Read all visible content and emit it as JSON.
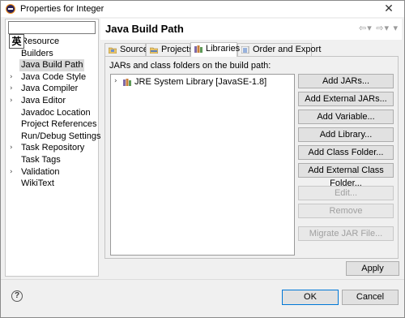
{
  "window": {
    "title": "Properties for Integer",
    "close_glyph": "✕"
  },
  "left_pane": {
    "filter_value": "",
    "ime_badge": "英",
    "items": [
      {
        "label": "Resource",
        "has_children": true,
        "selected": false
      },
      {
        "label": "Builders",
        "has_children": false,
        "selected": false
      },
      {
        "label": "Java Build Path",
        "has_children": false,
        "selected": true
      },
      {
        "label": "Java Code Style",
        "has_children": true,
        "selected": false
      },
      {
        "label": "Java Compiler",
        "has_children": true,
        "selected": false
      },
      {
        "label": "Java Editor",
        "has_children": true,
        "selected": false
      },
      {
        "label": "Javadoc Location",
        "has_children": false,
        "selected": false
      },
      {
        "label": "Project References",
        "has_children": false,
        "selected": false
      },
      {
        "label": "Run/Debug Settings",
        "has_children": false,
        "selected": false
      },
      {
        "label": "Task Repository",
        "has_children": true,
        "selected": false
      },
      {
        "label": "Task Tags",
        "has_children": false,
        "selected": false
      },
      {
        "label": "Validation",
        "has_children": true,
        "selected": false
      },
      {
        "label": "WikiText",
        "has_children": false,
        "selected": false
      }
    ]
  },
  "page": {
    "title": "Java Build Path",
    "nav": {
      "back": "⇦",
      "forward": "⇨",
      "dropdown": "▾",
      "menu": "▾"
    },
    "tabs": [
      {
        "label": "Source",
        "icon": "source-folder-icon",
        "active": false
      },
      {
        "label": "Projects",
        "icon": "projects-icon",
        "active": false
      },
      {
        "label": "Libraries",
        "icon": "libraries-icon",
        "active": true
      },
      {
        "label": "Order and Export",
        "icon": "order-export-icon",
        "active": false
      }
    ],
    "libraries": {
      "caption": "JARs and class folders on the build path:",
      "entries": [
        {
          "label": "JRE System Library [JavaSE-1.8]",
          "icon": "jre-library-icon"
        }
      ],
      "buttons": {
        "add_jars": "Add JARs...",
        "add_external_jars": "Add External JARs...",
        "add_variable": "Add Variable...",
        "add_library": "Add Library...",
        "add_class_folder": "Add Class Folder...",
        "add_external_class_folder": "Add External Class Folder...",
        "edit": "Edit...",
        "remove": "Remove",
        "migrate_jar": "Migrate JAR File..."
      }
    },
    "apply_label": "Apply"
  },
  "footer": {
    "help_glyph": "?",
    "ok_label": "OK",
    "cancel_label": "Cancel"
  },
  "colors": {
    "accent_border": "#0078d7",
    "selection": "#d9d9d9",
    "app_icon": "#2c2255"
  }
}
